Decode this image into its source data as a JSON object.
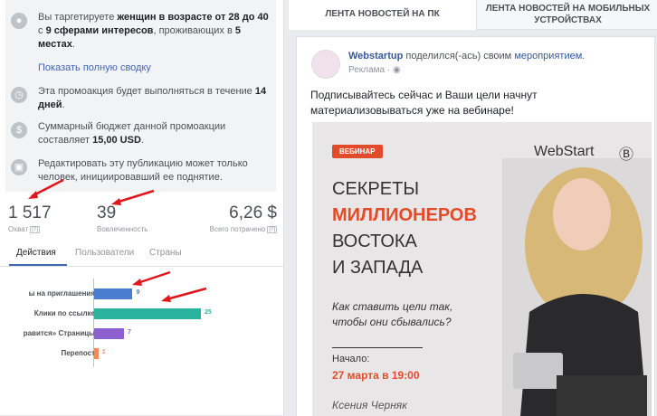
{
  "summary": {
    "item1": {
      "pre": "Вы таргетируете ",
      "b1": "женщин в возрасте от 28 до 40",
      "mid1": " с ",
      "b2": "9 сферами интересов",
      "mid2": ", проживающих в ",
      "b3": "5 местах",
      "post": "."
    },
    "show_summary_link": "Показать полную сводку",
    "item2": {
      "pre": "Эта промоакция будет выполняться в течение ",
      "b": "14 дней",
      "post": "."
    },
    "item3": {
      "pre": "Суммарный бюджет данной промоакции составляет ",
      "b": "15,00 USD",
      "post": "."
    },
    "item4": "Редактировать эту публикацию может только человек, инициировавший ее поднятие."
  },
  "metrics": [
    {
      "value": "1 517",
      "label": "Охват"
    },
    {
      "value": "39",
      "label": "Вовлеченность"
    },
    {
      "value": "6,26 $",
      "label": "Всего потрачено"
    }
  ],
  "help": "[?]",
  "tabs": [
    "Действия",
    "Пользователи",
    "Страны"
  ],
  "bar_chart": {
    "type": "bar",
    "categories": [
      "ы на приглашения",
      "Клики по ссылке",
      "равится» Страницы",
      "Перепост"
    ],
    "values": [
      9,
      25,
      7,
      1
    ],
    "colors": [
      "#4a7cd0",
      "#2bb3a0",
      "#8e5fce",
      "#f28a5a"
    ]
  },
  "right_tabs": [
    "ЛЕНТА НОВОСТЕЙ НА ПК",
    "ЛЕНТА НОВОСТЕЙ НА МОБИЛЬНЫХ УСТРОЙСТВАХ"
  ],
  "post": {
    "author": "Webstartup",
    "action": " поделился(-ась) своим ",
    "event_link": "мероприятием",
    "end": ".",
    "sponsored": "Реклама",
    "text": "Подписывайтесь сейчас и Ваши цели начнут материализовываться уже на вебинаре!",
    "ad": {
      "badge": "ВЕБИНАР",
      "logo": "WebStart",
      "logo_icon": "Ⓑ",
      "line1": "СЕКРЕТЫ",
      "line2": "МИЛЛИОНЕРОВ",
      "line3": "ВОСТОКА",
      "line4": "И ЗАПАДА",
      "italic1": "Как ставить цели так,",
      "italic2": "чтобы они сбывались?",
      "start_label": "Начало:",
      "date": "27 марта  в 19:00",
      "signature": "Ксения Черняк"
    }
  },
  "colors": {
    "accent": "#4267b2",
    "arrow": "#e0161b",
    "brand": "#e24c2a"
  }
}
